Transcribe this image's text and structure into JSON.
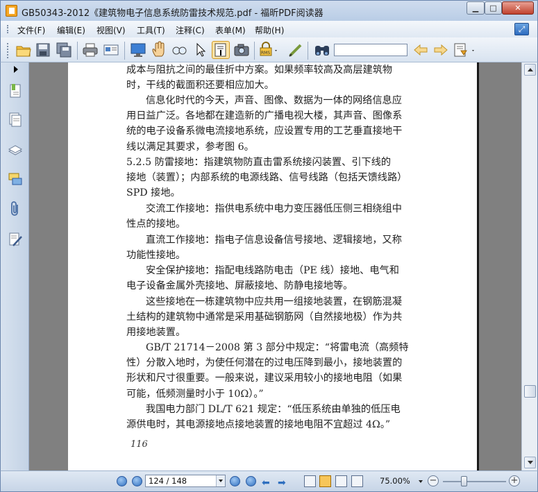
{
  "window": {
    "title": "GB50343-2012《建筑物电子信息系统防雷技术规范.pdf - 福昕PDF阅读器"
  },
  "menu": {
    "items": [
      "文件(F)",
      "编辑(E)",
      "视图(V)",
      "工具(T)",
      "注释(C)",
      "表单(M)",
      "帮助(H)"
    ]
  },
  "toolbar": {
    "buttons": [
      "open-icon",
      "save-icon",
      "save-all-icon",
      "print-icon",
      "email-icon",
      "fullscreen-icon",
      "hand-tool-icon",
      "zoom-tool-icon",
      "select-arrow-icon",
      "text-select-icon",
      "snapshot-icon",
      "rms-icon",
      "sign-icon",
      "find-binoculars-icon",
      "search-prev-icon",
      "search-next-icon",
      "search-options-icon"
    ],
    "search_value": ""
  },
  "left_panel": {
    "icons": [
      "bookmarks-icon",
      "pages-icon",
      "layers-icon",
      "comments-icon",
      "attachments-icon",
      "signatures-icon"
    ]
  },
  "document": {
    "lines": [
      "成本与阻抗之间的最佳折中方案。如果频率较高及高层建筑物",
      "时，干线的截面积还要相应加大。",
      "信息化时代的今天，声音、图像、数据为一体的网络信息应",
      "用日益广泛。各地都在建造新的广播电视大楼，其声音、图像系",
      "统的电子设备系微电流接地系统，应设置专用的工艺垂直接地干",
      "线以满足其要求，参考图 6。",
      "5.2.5  防雷接地：指建筑物防直击雷系统接闪装置、引下线的",
      "接地（装置）；内部系统的电源线路、信号线路（包括天馈线路）",
      "SPD 接地。",
      "交流工作接地：指供电系统中电力变压器低压侧三相绕组中",
      "性点的接地。",
      "直流工作接地：指电子信息设备信号接地、逻辑接地，又称",
      "功能性接地。",
      "安全保护接地：指配电线路防电击（PE 线）接地、电气和",
      "电子设备金属外壳接地、屏蔽接地、防静电接地等。",
      "这些接地在一栋建筑物中应共用一组接地装置，在钢筋混凝",
      "土结构的建筑物中通常是采用基础钢筋网（自然接地极）作为共",
      "用接地装置。",
      "GB/T 21714－2008 第 3 部分中规定：“将雷电流（高频特",
      "性）分散入地时，为使任何潜在的过电压降到最小，接地装置的",
      "形状和尺寸很重要。一般来说，建议采用较小的接地电阻（如果",
      "可能，低频测量时小于 10Ω）。”",
      "我国电力部门 DL/T 621 规定：“低压系统由单独的低压电",
      "源供电时，其电源接地点接地装置的接地电阻不宜超过 4Ω。”"
    ],
    "page_number": "116"
  },
  "statusbar": {
    "page_field": "124 / 148",
    "zoom": "75.00%"
  }
}
